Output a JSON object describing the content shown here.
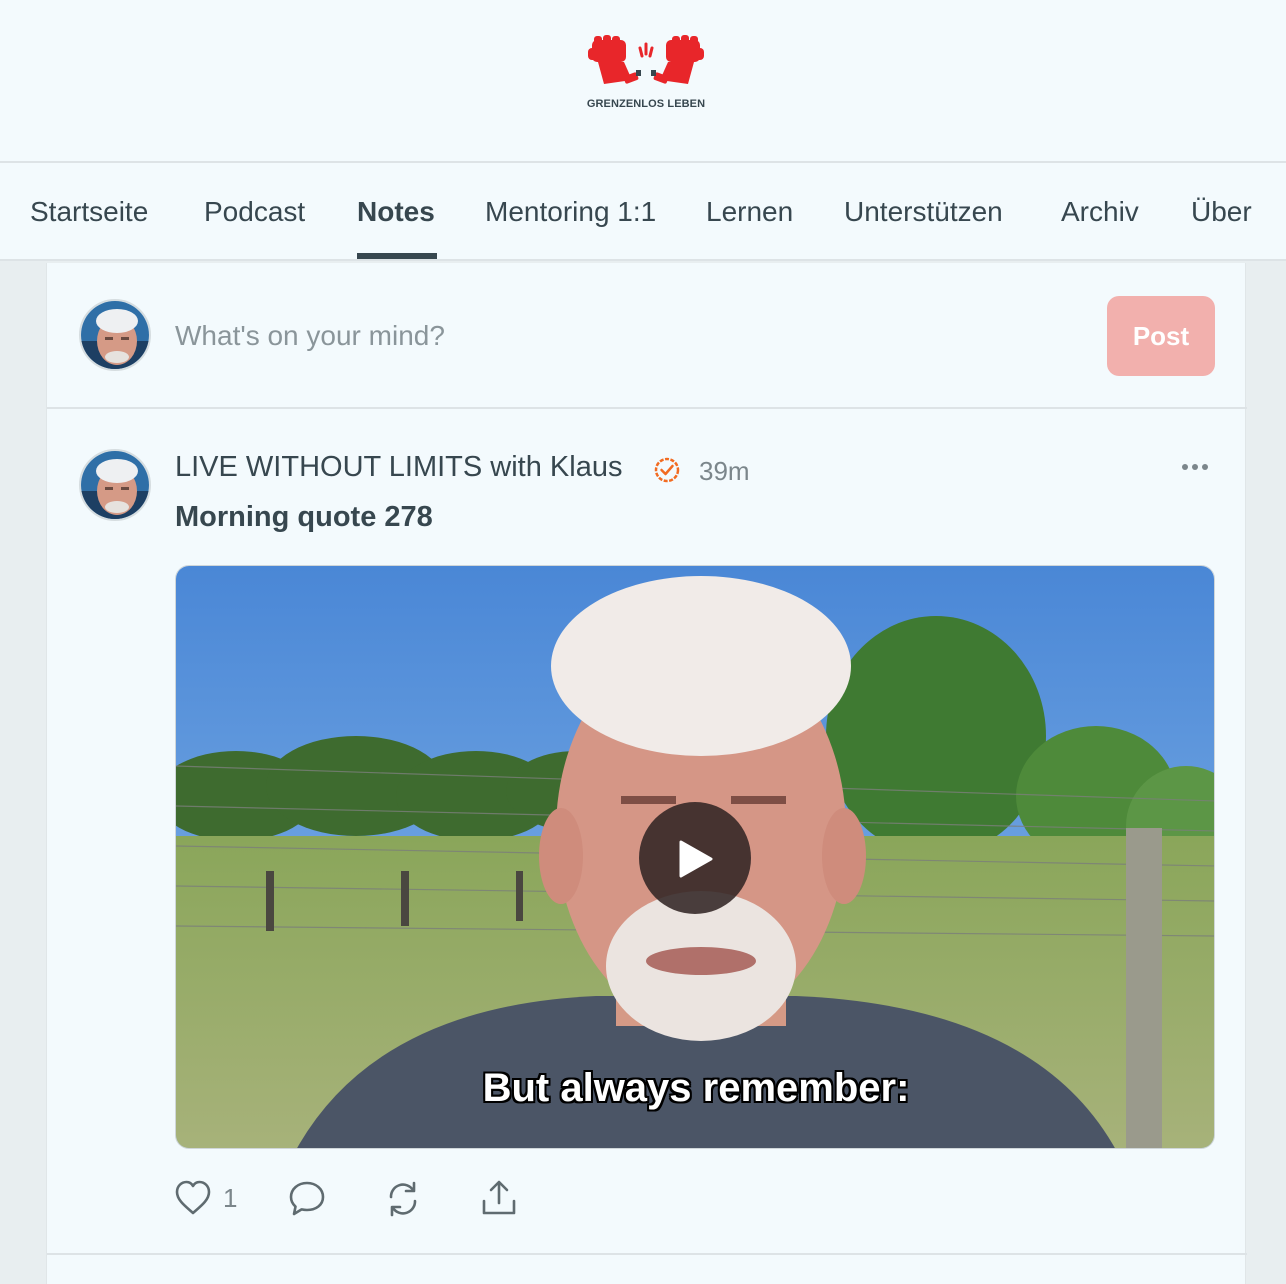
{
  "brand": {
    "logo_text": "GRENZENLOS LEBEN",
    "accent_color": "#e8262a"
  },
  "nav": {
    "items": [
      {
        "label": "Startseite",
        "active": false
      },
      {
        "label": "Podcast",
        "active": false
      },
      {
        "label": "Notes",
        "active": true
      },
      {
        "label": "Mentoring 1:1",
        "active": false
      },
      {
        "label": "Lernen",
        "active": false
      },
      {
        "label": "Unterstützen",
        "active": false
      },
      {
        "label": "Archiv",
        "active": false
      },
      {
        "label": "Über",
        "active": false
      }
    ]
  },
  "composer": {
    "placeholder": "What's on your mind?",
    "post_label": "Post",
    "post_button_color": "#f2b0ad"
  },
  "note": {
    "author": "LIVE WITHOUT LIMITS with Klaus",
    "verified_icon": "verified-check-icon",
    "verified_color": "#f26b21",
    "time": "39m",
    "title": "Morning quote 278",
    "video": {
      "caption": "But always remember:",
      "play_icon": "play-icon"
    },
    "actions": {
      "like_icon": "heart-icon",
      "like_count": "1",
      "comment_icon": "comment-icon",
      "restack_icon": "restack-icon",
      "share_icon": "share-icon",
      "more_icon": "ellipsis-icon"
    }
  }
}
